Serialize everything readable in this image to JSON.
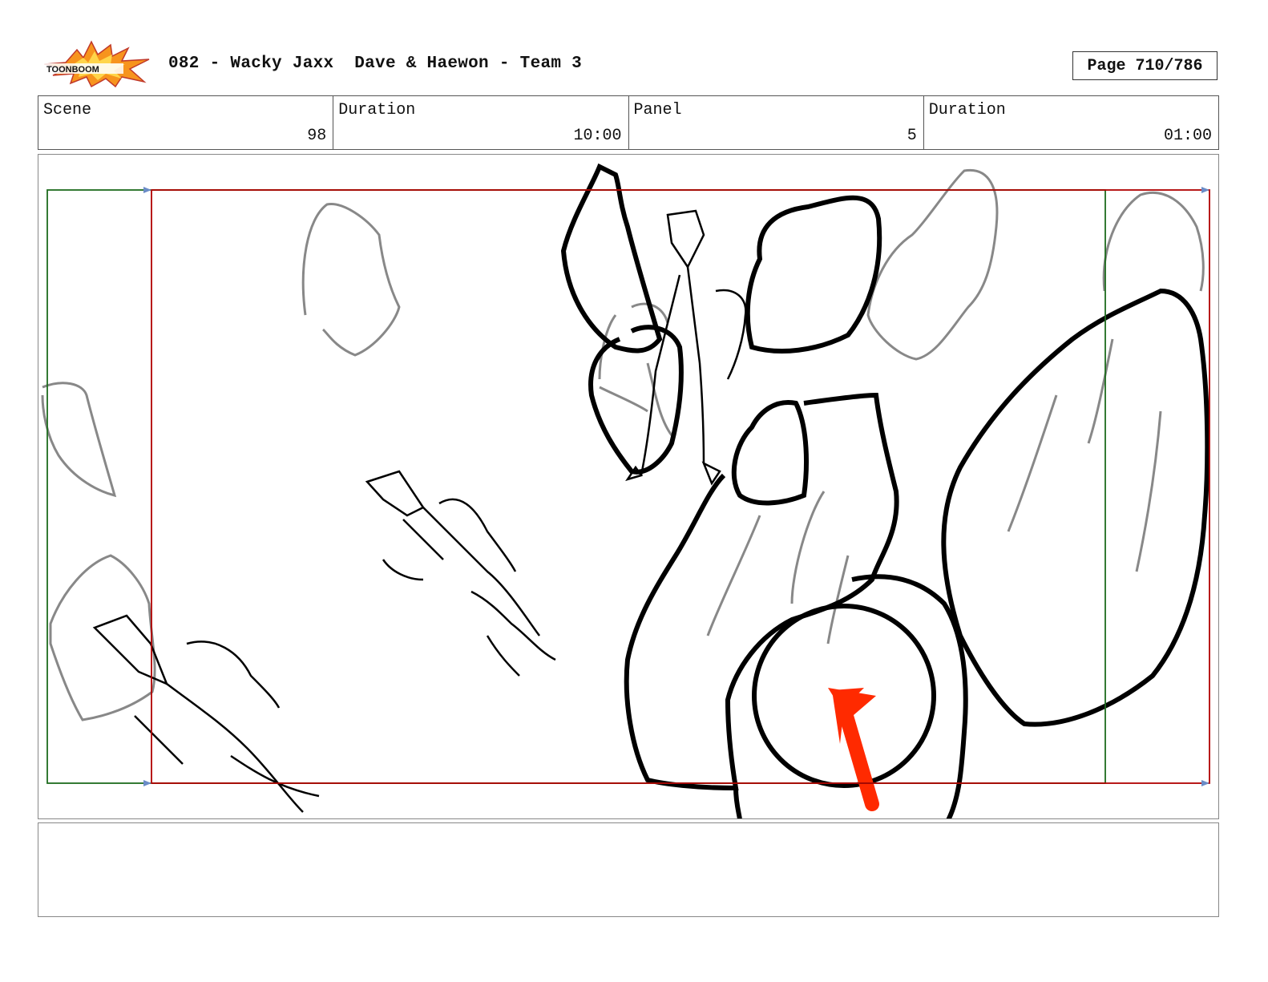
{
  "header": {
    "logo": {
      "name": "toonboom-logo",
      "text": "TOONBOOM"
    },
    "title": "082 - Wacky Jaxx  Dave & Haewon - Team 3",
    "page_label": "Page 710/786"
  },
  "info": {
    "scene_label": "Scene",
    "scene_value": "98",
    "scene_duration_label": "Duration",
    "scene_duration_value": "10:00",
    "panel_label": "Panel",
    "panel_value": "5",
    "panel_duration_label": "Duration",
    "panel_duration_value": "01:00"
  },
  "colors": {
    "safe_frame": "#b00000",
    "action_frame": "#1e6b1e",
    "arrow": "#ff2a00",
    "logo_orange": "#f7941d",
    "sketch_dark": "#000000",
    "sketch_grey": "#888888"
  },
  "notes": {
    "text": ""
  }
}
